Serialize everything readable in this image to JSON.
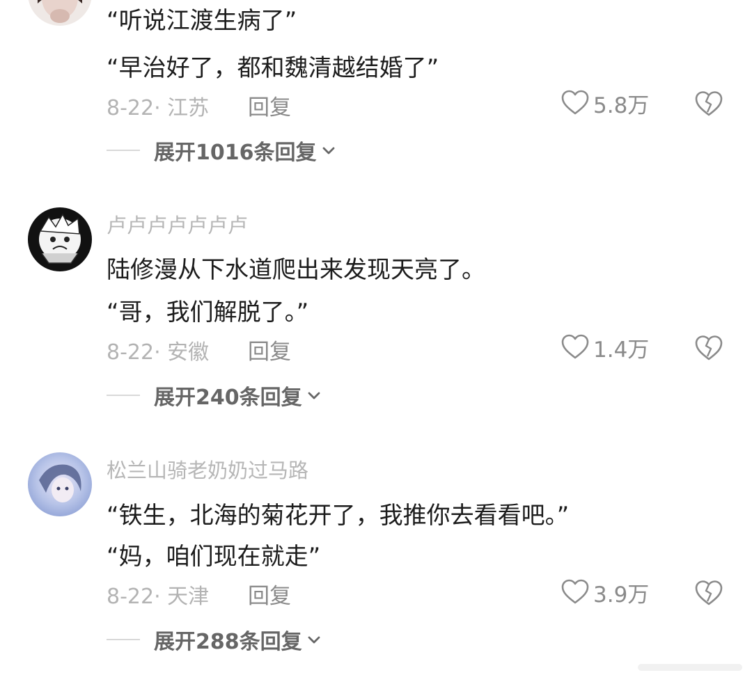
{
  "comments": [
    {
      "lines": [
        "“听说江渡生病了”",
        "“早治好了，都和魏清越结婚了”"
      ],
      "date_location": "8-22· 江苏",
      "reply_label": "回复",
      "likes": "5.8万",
      "expand_label": "展开1016条回复"
    },
    {
      "username": "卢卢卢卢卢卢卢",
      "lines": [
        "陆修漫从下水道爬出来发现天亮了。",
        "“哥，我们解脱了。”"
      ],
      "date_location": "8-22· 安徽",
      "reply_label": "回复",
      "likes": "1.4万",
      "expand_label": "展开240条回复"
    },
    {
      "username": "松兰山骑老奶奶过马路",
      "lines": [
        "“铁生，北海的菊花开了，我推你去看看吧。”",
        "“妈，咱们现在就走”"
      ],
      "date_location": "8-22· 天津",
      "reply_label": "回复",
      "likes": "3.9万",
      "expand_label": "展开288条回复"
    }
  ],
  "icons": {
    "like": "heart-outline-icon",
    "dislike": "broken-heart-icon",
    "expand": "chevron-down-icon"
  },
  "colors": {
    "username": "#b6b6b6",
    "text": "#1c1c1c",
    "meta": "#b3b3b3",
    "secondary": "#8a8a8a",
    "expand": "#666666"
  }
}
